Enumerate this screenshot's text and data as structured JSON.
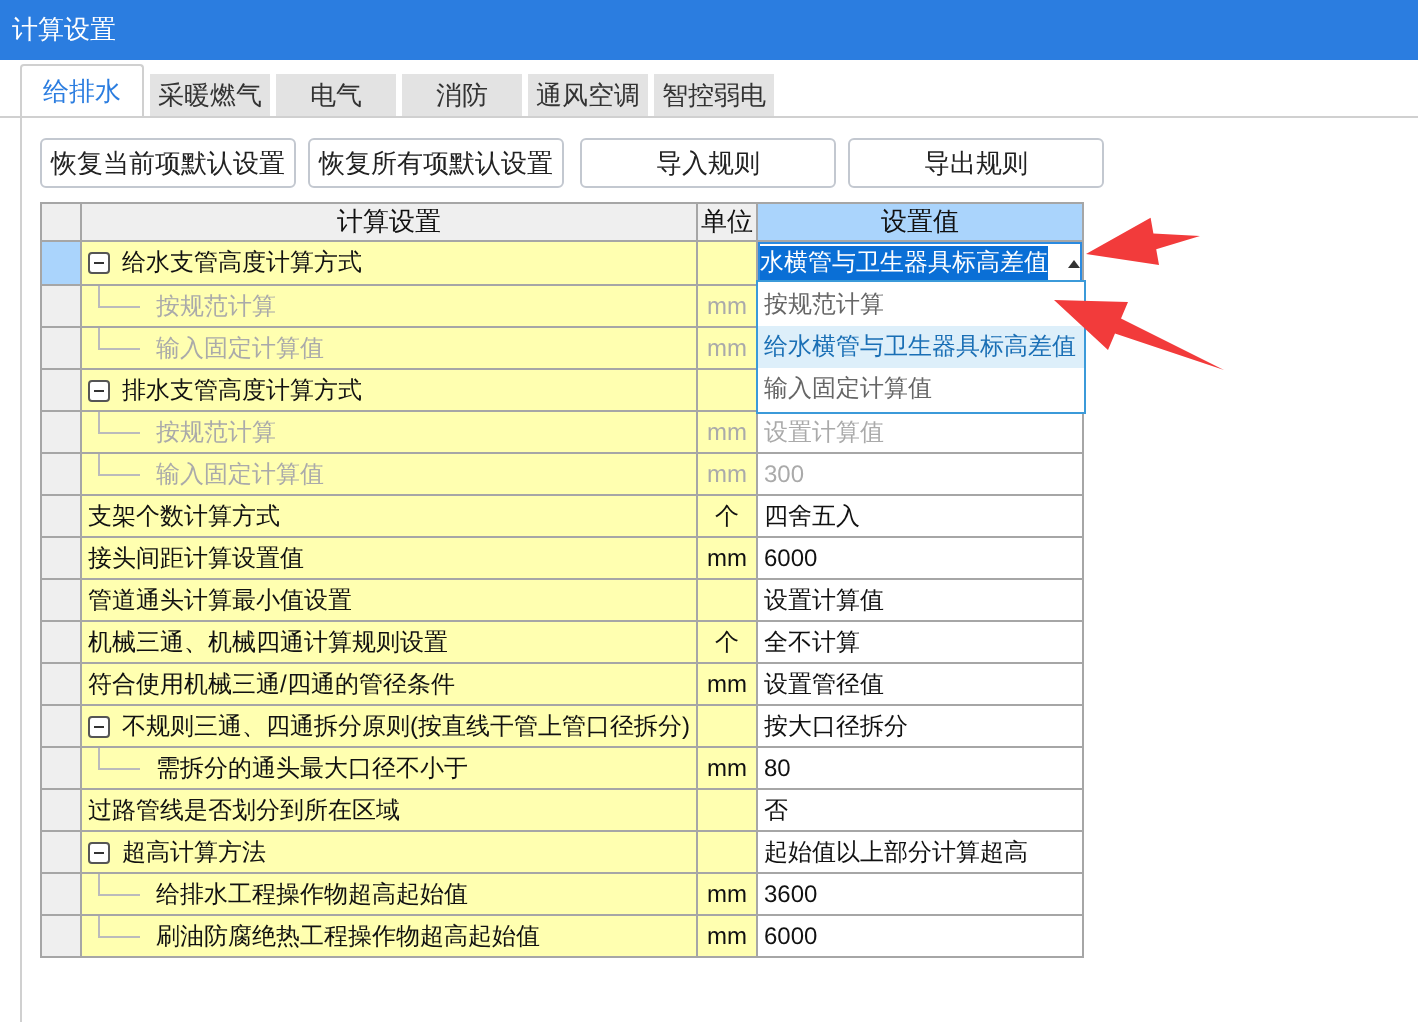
{
  "window": {
    "title": "计算设置"
  },
  "tabs": [
    {
      "label": "给排水",
      "selected": true
    },
    {
      "label": "采暖燃气",
      "selected": false
    },
    {
      "label": "电气",
      "selected": false
    },
    {
      "label": "消防",
      "selected": false
    },
    {
      "label": "通风空调",
      "selected": false
    },
    {
      "label": "智控弱电",
      "selected": false
    }
  ],
  "buttons": [
    "恢复当前项默认设置",
    "恢复所有项默认设置",
    "导入规则",
    "导出规则"
  ],
  "table": {
    "columns": [
      "计算设置",
      "单位",
      "设置值"
    ],
    "rows": [
      {
        "name": "给水支管高度计算方式",
        "unit": "",
        "value": "水横管与卫生器具标高差值",
        "selected": true,
        "editing": true,
        "expanded": true,
        "children": [
          {
            "name": "按规范计算",
            "unit": "mm",
            "disabled": true,
            "selected": false
          },
          {
            "name": "输入固定计算值",
            "unit": "mm",
            "disabled": true,
            "selected": false
          }
        ]
      },
      {
        "name": "排水支管高度计算方式",
        "unit": "",
        "value": "",
        "selected": false,
        "editing": false,
        "expanded": true,
        "children": [
          {
            "name": "按规范计算",
            "unit": "mm",
            "value": "设置计算值",
            "disabled": true,
            "selected": false
          },
          {
            "name": "输入固定计算值",
            "unit": "mm",
            "value": "300",
            "disabled": true,
            "selected": false
          }
        ]
      },
      {
        "name": "支架个数计算方式",
        "unit": "个",
        "value": "四舍五入",
        "selected": false,
        "editing": false
      },
      {
        "name": "接头间距计算设置值",
        "unit": "mm",
        "value": "6000",
        "selected": false,
        "editing": false
      },
      {
        "name": "管道通头计算最小值设置",
        "unit": "",
        "value": "设置计算值",
        "selected": false,
        "editing": false
      },
      {
        "name": "机械三通、机械四通计算规则设置",
        "unit": "个",
        "value": "全不计算",
        "selected": false,
        "editing": false
      },
      {
        "name": "符合使用机械三通/四通的管径条件",
        "unit": "mm",
        "value": "设置管径值",
        "selected": false,
        "editing": false
      },
      {
        "name": "不规则三通、四通拆分原则(按直线干管上管口径拆分)",
        "unit": "",
        "value": "按大口径拆分",
        "selected": false,
        "editing": false,
        "expanded": true,
        "children": [
          {
            "name": "需拆分的通头最大口径不小于",
            "unit": "mm",
            "value": "80",
            "disabled": false,
            "selected": false
          }
        ]
      },
      {
        "name": "过路管线是否划分到所在区域",
        "unit": "",
        "value": "否",
        "selected": false,
        "editing": false
      },
      {
        "name": "超高计算方法",
        "unit": "",
        "value": "起始值以上部分计算超高",
        "selected": false,
        "editing": false,
        "expanded": true,
        "children": [
          {
            "name": "给排水工程操作物超高起始值",
            "unit": "mm",
            "value": "3600",
            "disabled": false,
            "selected": false
          },
          {
            "name": "刷油防腐绝热工程操作物超高起始值",
            "unit": "mm",
            "value": "6000",
            "disabled": false,
            "selected": false
          }
        ]
      }
    ]
  },
  "dropdown": {
    "options": [
      {
        "label": "按规范计算",
        "selected": false
      },
      {
        "label": "给水横管与卫生器具标高差值",
        "selected": true
      },
      {
        "label": "输入固定计算值",
        "selected": false
      }
    ]
  }
}
